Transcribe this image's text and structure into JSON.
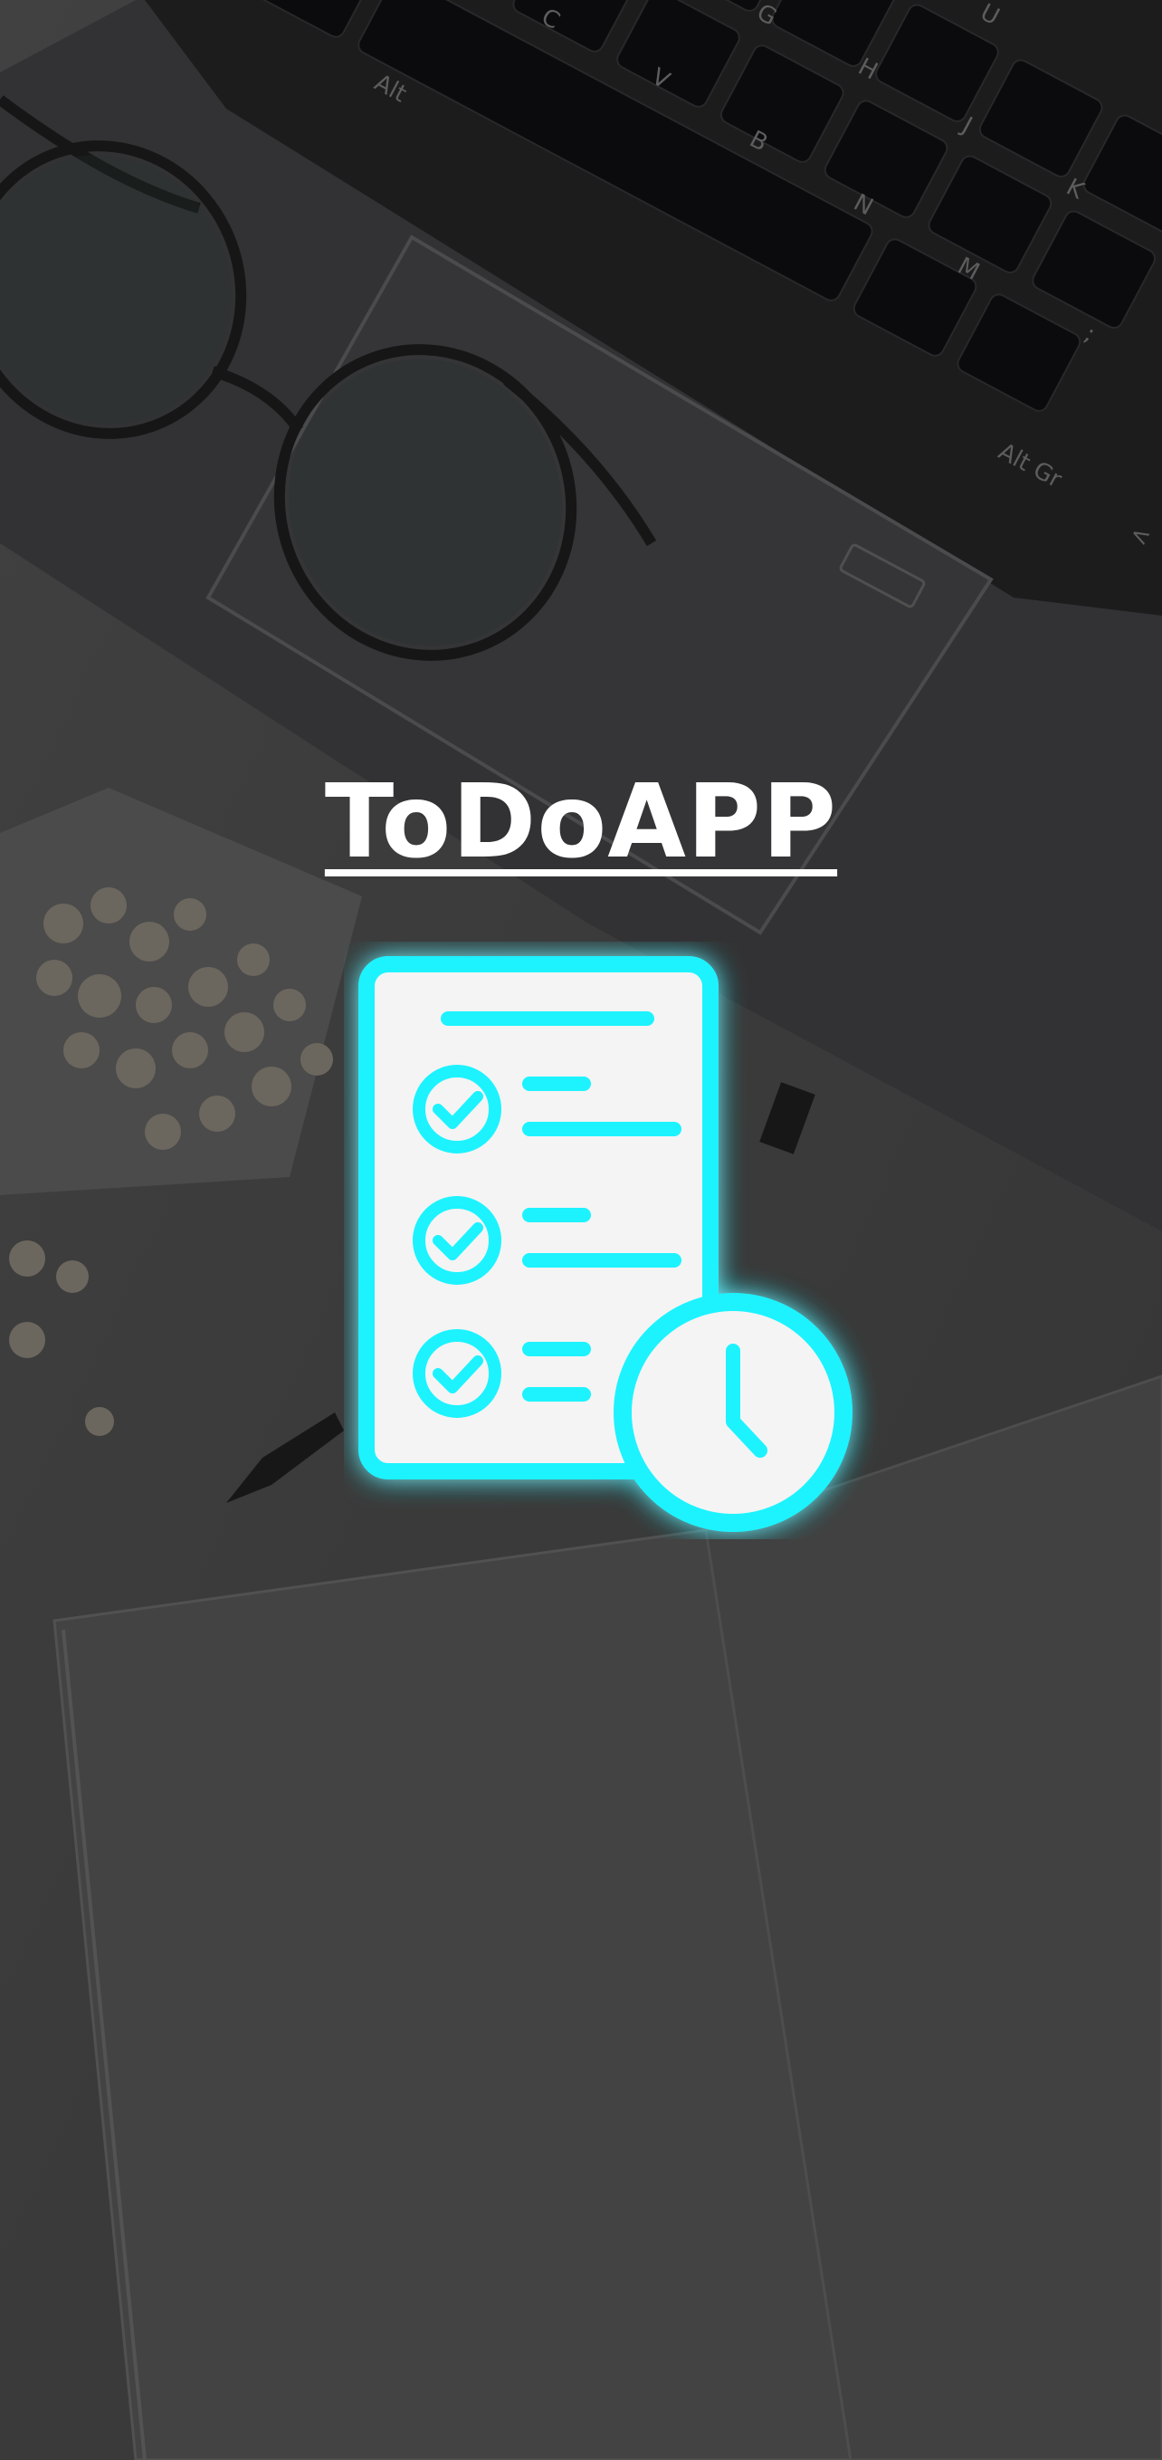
{
  "app": {
    "title": "ToDoAPP"
  },
  "splash": {
    "logo_icon": "checklist-clock-icon",
    "accent_color": "#1ef3ff",
    "background_scene": "dimmed-desk-laptop-photo"
  },
  "background": {
    "keyboard_keys": [
      "Alt",
      "C",
      "V",
      "B",
      "N",
      "M",
      "G",
      "H",
      "J",
      "K",
      "U",
      "Alt Gr",
      ";",
      "<"
    ]
  }
}
